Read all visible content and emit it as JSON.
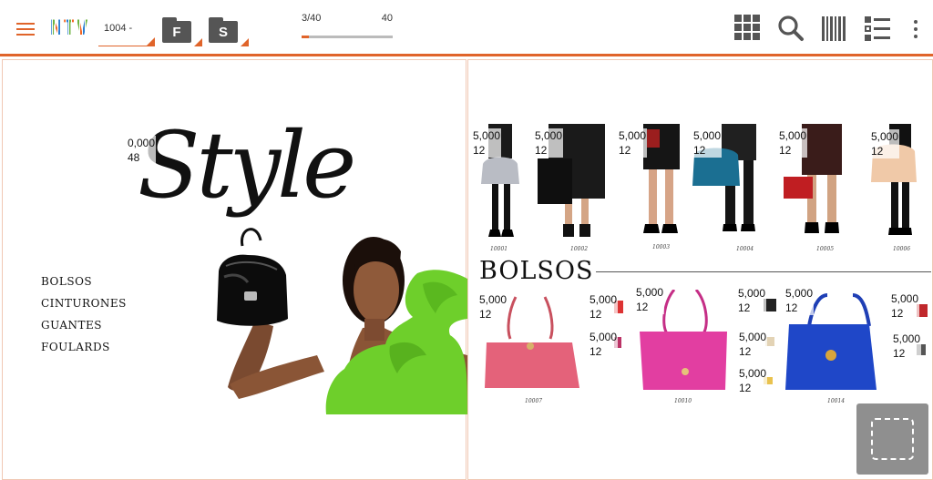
{
  "toolbar": {
    "logo_text": "NTV",
    "selector_value": "1004 -",
    "folder_f_label": "F",
    "folder_s_label": "S",
    "page_current": "3/40",
    "page_total": "40",
    "page_progress_fraction": 0.075,
    "accent_color": "#e0642a",
    "icons": [
      "menu-icon",
      "grid-icon",
      "search-icon",
      "barcode-icon",
      "list-icon",
      "more-vert-icon"
    ]
  },
  "left_page": {
    "title": "Style",
    "price": {
      "value": "0,000",
      "qty": "48"
    },
    "categories": [
      "BOLSOS",
      "CINTURONES",
      "GUANTES",
      "FOULARDS"
    ]
  },
  "right_page": {
    "models": [
      {
        "price": "5,000",
        "qty": "12",
        "code": "10001"
      },
      {
        "price": "5,000",
        "qty": "12",
        "code": "10002"
      },
      {
        "price": "5,000",
        "qty": "12",
        "code": "10003"
      },
      {
        "price": "5,000",
        "qty": "12",
        "code": "10004"
      },
      {
        "price": "5,000",
        "qty": "12",
        "code": "10005"
      },
      {
        "price": "5,000",
        "qty": "12",
        "code": "10006"
      }
    ],
    "heading": "BOLSOS",
    "bags": [
      {
        "price": "5,000",
        "qty": "12",
        "code": "10007"
      },
      {
        "price": "5,000",
        "qty": "12"
      },
      {
        "price": "5,000",
        "qty": "12"
      },
      {
        "price": "5,000",
        "qty": "12",
        "code": "10010"
      },
      {
        "price": "5,000",
        "qty": "12"
      },
      {
        "price": "5,000",
        "qty": "12"
      },
      {
        "price": "5,000",
        "qty": "12"
      },
      {
        "price": "5,000",
        "qty": "12",
        "code": "10014"
      },
      {
        "price": "5,000",
        "qty": "12"
      },
      {
        "price": "5,000",
        "qty": "12"
      }
    ]
  },
  "fab_icon": "select-area-icon"
}
